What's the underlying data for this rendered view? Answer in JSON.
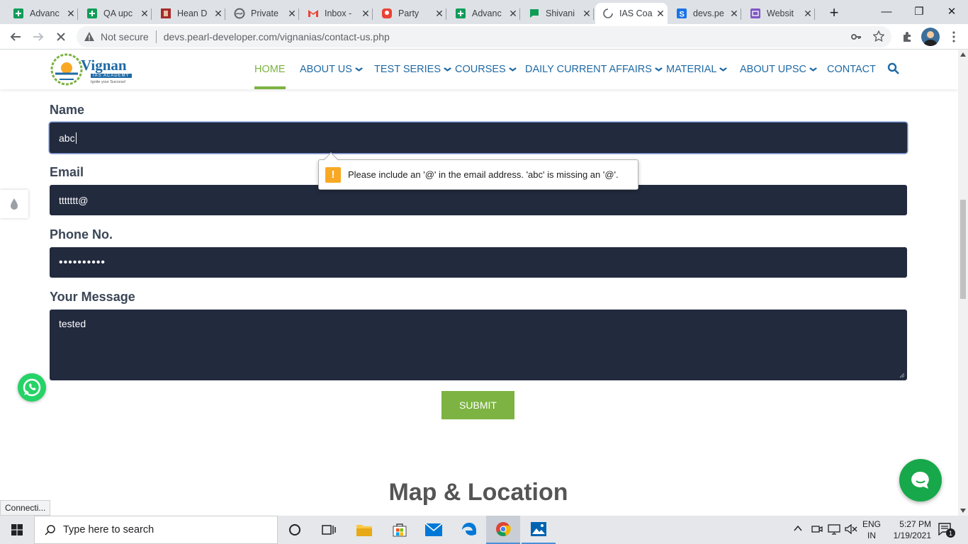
{
  "browser": {
    "tabs": [
      {
        "title": "Advanc",
        "icon": "sheets-icon",
        "color": "#0f9d58"
      },
      {
        "title": "QA upc",
        "icon": "sheets-icon",
        "color": "#0f9d58"
      },
      {
        "title": "Hean D",
        "icon": "book-icon",
        "color": "#a52a2a"
      },
      {
        "title": "Private",
        "icon": "globe-icon",
        "color": "#5f6368"
      },
      {
        "title": "Inbox -",
        "icon": "gmail-icon",
        "color": "#ea4335"
      },
      {
        "title": "Party",
        "icon": "location-icon",
        "color": "#ea4335"
      },
      {
        "title": "Advanc",
        "icon": "sheets-icon",
        "color": "#0f9d58"
      },
      {
        "title": "Shivani",
        "icon": "chat-icon",
        "color": "#0f9d58"
      },
      {
        "title": "IAS Coa",
        "icon": "loading-icon",
        "color": "#5f6368",
        "active": true
      },
      {
        "title": "devs.pe",
        "icon": "s-icon",
        "color": "#1a73e8"
      },
      {
        "title": "Websit",
        "icon": "site-icon",
        "color": "#7e57c2"
      }
    ],
    "new_tab": "+",
    "window_controls": {
      "minimize": "—",
      "maximize": "❐",
      "close": "✕"
    },
    "security_label": "Not secure",
    "url": "devs.pearl-developer.com/vignanias/contact-us.php",
    "status_text": "Connecti..."
  },
  "site": {
    "logo": {
      "name": "Vignan",
      "sub": "IAS ACADEMY",
      "tagline": "Ignite your Success!"
    },
    "nav": [
      {
        "label": "HOME",
        "dropdown": false,
        "active": true
      },
      {
        "label": "ABOUT US",
        "dropdown": true
      },
      {
        "label": "TEST SERIES",
        "dropdown": true
      },
      {
        "label": "COURSES",
        "dropdown": true
      },
      {
        "label": "DAILY CURRENT AFFAIRS",
        "dropdown": true
      },
      {
        "label": "MATERIAL",
        "dropdown": true
      },
      {
        "label": "ABOUT UPSC",
        "dropdown": true
      },
      {
        "label": "CONTACT",
        "dropdown": false
      }
    ],
    "colors": {
      "nav": "#1f6aa5",
      "active": "#7cb342",
      "field_bg": "#222a3e"
    }
  },
  "form": {
    "name_label": "Name",
    "name_value": "abc",
    "email_label": "Email",
    "email_value": "ttttttt@",
    "phone_label": "Phone No.",
    "phone_value": "••••••••••",
    "message_label": "Your Message",
    "message_value": "tested",
    "submit_label": "SUBMIT",
    "validation_message": "Please include an '@' in the email address. 'abc' is missing an '@'.",
    "validation_icon": "!"
  },
  "section": {
    "map_title": "Map & Location"
  },
  "taskbar": {
    "search_placeholder": "Type here to search",
    "lang_line1": "ENG",
    "lang_line2": "IN",
    "time": "5:27 PM",
    "date": "1/19/2021",
    "notification_count": "1"
  }
}
